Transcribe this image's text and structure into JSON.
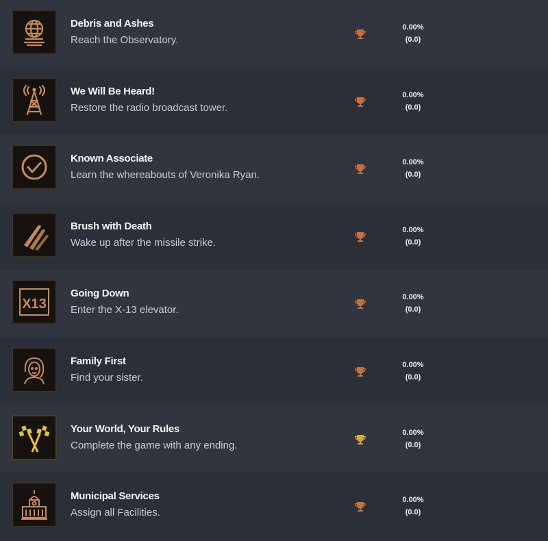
{
  "achievements": [
    {
      "title": "Debris and Ashes",
      "description": "Reach the Observatory.",
      "percent": "0.00%",
      "score": "(0.0)",
      "icon": "globe-observatory-icon",
      "trophy_color": "#c8703a"
    },
    {
      "title": "We Will Be Heard!",
      "description": "Restore the radio broadcast tower.",
      "percent": "0.00%",
      "score": "(0.0)",
      "icon": "radio-tower-icon",
      "trophy_color": "#c8703a"
    },
    {
      "title": "Known Associate",
      "description": "Learn the whereabouts of Veronika Ryan.",
      "percent": "0.00%",
      "score": "(0.0)",
      "icon": "checkmark-circle-icon",
      "trophy_color": "#c8703a"
    },
    {
      "title": "Brush with Death",
      "description": "Wake up after the missile strike.",
      "percent": "0.00%",
      "score": "(0.0)",
      "icon": "missiles-icon",
      "trophy_color": "#c8703a"
    },
    {
      "title": "Going Down",
      "description": "Enter the X-13 elevator.",
      "percent": "0.00%",
      "score": "(0.0)",
      "icon": "x13-sign-icon",
      "icon_text": "X13",
      "trophy_color": "#c8703a"
    },
    {
      "title": "Family First",
      "description": "Find your sister.",
      "percent": "0.00%",
      "score": "(0.0)",
      "icon": "woman-portrait-icon",
      "trophy_color": "#c8703a"
    },
    {
      "title": "Your World, Your Rules",
      "description": "Complete the game with any ending.",
      "percent": "0.00%",
      "score": "(0.0)",
      "icon": "checkered-flags-icon",
      "trophy_color": "#d9a93a"
    },
    {
      "title": "Municipal Services",
      "description": "Assign all Facilities.",
      "percent": "0.00%",
      "score": "(0.0)",
      "icon": "town-hall-icon",
      "trophy_color": "#c8703a"
    }
  ]
}
